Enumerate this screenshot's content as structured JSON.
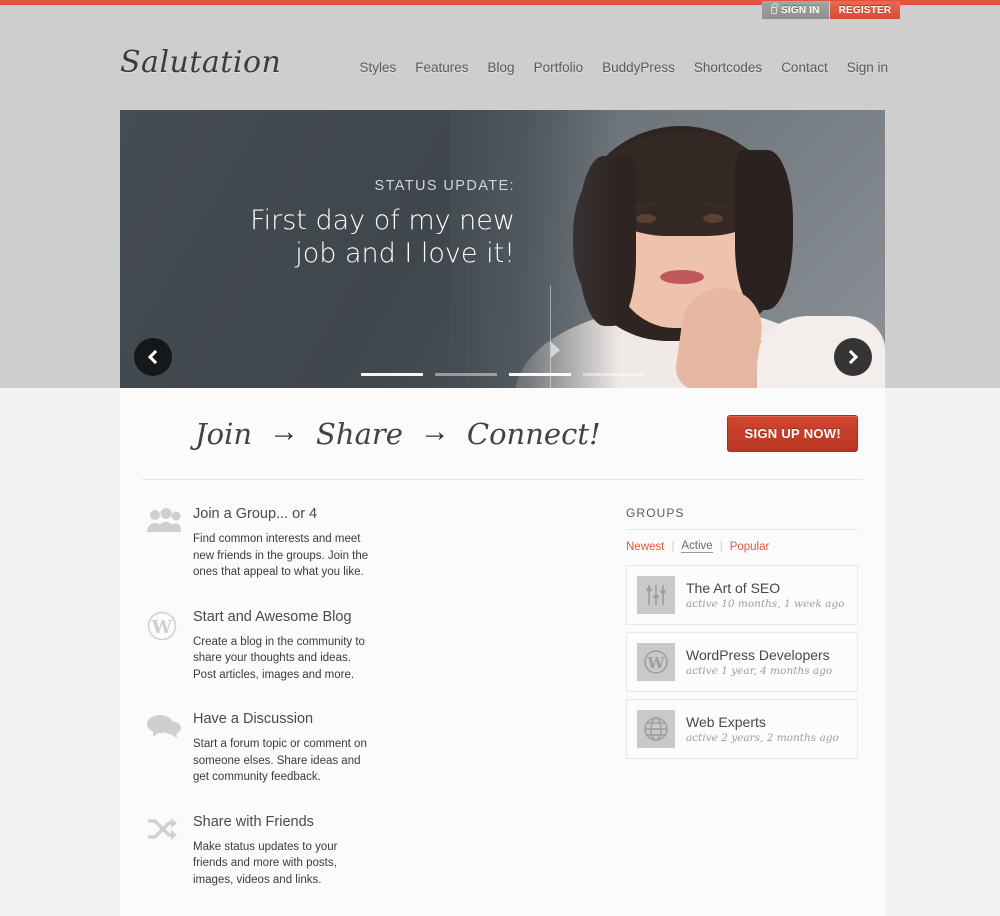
{
  "topbar": {
    "accent_color": "#e2523c",
    "signin_label": "SIGN IN",
    "register_label": "REGISTER"
  },
  "header": {
    "logo": "Salutation",
    "nav": [
      {
        "label": "Styles"
      },
      {
        "label": "Features"
      },
      {
        "label": "Blog"
      },
      {
        "label": "Portfolio"
      },
      {
        "label": "BuddyPress"
      },
      {
        "label": "Shortcodes"
      },
      {
        "label": "Contact"
      },
      {
        "label": "Sign in"
      }
    ]
  },
  "slider": {
    "kicker": "STATUS UPDATE:",
    "title_line1": "First day of my new",
    "title_line2": "job and I love it!",
    "prev_label": "‹",
    "next_label": "›",
    "pager_count": 4,
    "pager_active_index": 0
  },
  "cta": {
    "step1": "Join",
    "arrow1": "→",
    "step2": "Share",
    "arrow2": "→",
    "step3": "Connect!",
    "button_label": "SIGN UP NOW!",
    "button_color": "#c43e28"
  },
  "features": [
    {
      "icon": "group-users-icon",
      "title": "Join a Group... or 4",
      "text": "Find common interests and meet new friends in the groups. Join the ones that appeal to what you like."
    },
    {
      "icon": "wordpress-icon",
      "title": "Start and Awesome Blog",
      "text": "Create a blog in the community to share your thoughts and ideas. Post articles, images and more."
    },
    {
      "icon": "speech-bubbles-icon",
      "title": "Have a Discussion",
      "text": "Start a forum topic or comment on someone elses. Share ideas and get community feedback."
    },
    {
      "icon": "shuffle-arrows-icon",
      "title": "Share with Friends",
      "text": "Make status updates to your friends and more with posts, images, videos and links."
    }
  ],
  "sidebar": {
    "title": "GROUPS",
    "tabs": [
      {
        "label": "Newest",
        "active": false
      },
      {
        "label": "Active",
        "active": true
      },
      {
        "label": "Popular",
        "active": false
      }
    ],
    "separator": "|",
    "groups": [
      {
        "avatar_icon": "sliders-icon",
        "name": "The Art of SEO",
        "meta": "active 10 months, 1 week ago"
      },
      {
        "avatar_icon": "wordpress-icon",
        "name": "WordPress Developers",
        "meta": "active 1 year, 4 months ago"
      },
      {
        "avatar_icon": "globe-icon",
        "name": "Web Experts",
        "meta": "active 2 years, 2 months ago"
      }
    ]
  }
}
